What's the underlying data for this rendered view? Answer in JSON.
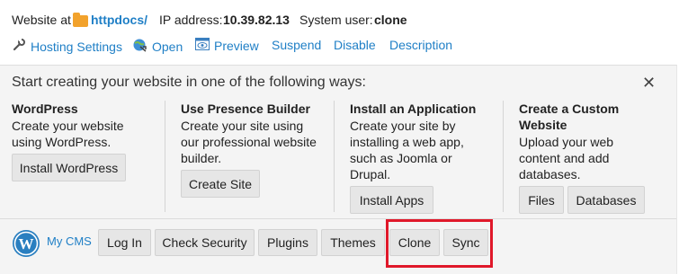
{
  "header": {
    "website_at_label": "Website at",
    "domain_folder": "httpdocs/",
    "ip_label": "IP address:",
    "ip_value": "10.39.82.13",
    "user_label": "System user:",
    "user_value": "clone"
  },
  "toolbar": {
    "hosting_settings": "Hosting Settings",
    "open": "Open",
    "preview": "Preview",
    "suspend": "Suspend",
    "disable": "Disable",
    "description": "Description"
  },
  "panel": {
    "title": "Start creating your website in one of the following ways:",
    "close_icon": "close-icon",
    "columns": [
      {
        "title": "WordPress",
        "desc": [
          "Create your website",
          "using WordPress."
        ],
        "buttons": [
          "Install WordPress"
        ]
      },
      {
        "title": "Use Presence Builder",
        "desc": [
          "Create your site using",
          "our professional website",
          "builder."
        ],
        "buttons": [
          "Create Site"
        ]
      },
      {
        "title": "Install an Application",
        "desc": [
          "Create your site by",
          "installing a web app,",
          "such as Joomla or",
          "Drupal."
        ],
        "buttons": [
          "Install Apps"
        ]
      },
      {
        "title": [
          "Create a Custom",
          "Website"
        ],
        "desc": [
          "Upload your web",
          "content and add",
          "databases."
        ],
        "buttons": [
          "Files",
          "Databases"
        ]
      }
    ]
  },
  "cms": {
    "label": "My CMS",
    "buttons": [
      "Log In",
      "Check Security",
      "Plugins",
      "Themes",
      "Clone",
      "Sync"
    ]
  },
  "colors": {
    "link": "#1f7fc6",
    "highlight": "#e0182a",
    "folder": "#f2a22c"
  }
}
